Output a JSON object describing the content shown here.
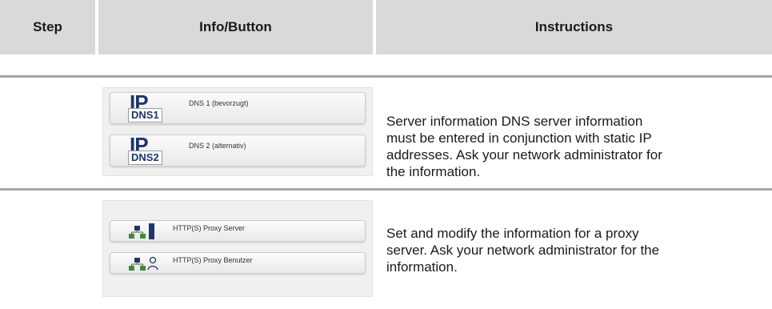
{
  "header": {
    "step": "Step",
    "info_button": "Info/Button",
    "instructions": "Instructions"
  },
  "rows": [
    {
      "buttons": [
        {
          "icon": "ip-dns1-icon",
          "icon_text": "DNS1",
          "label": "DNS 1 (bevorzugt)"
        },
        {
          "icon": "ip-dns2-icon",
          "icon_text": "DNS2",
          "label": "DNS 2 (alternativ)"
        }
      ],
      "ip_text": "IP",
      "lines": [
        "Server information DNS server information",
        "must be entered in conjunction with static IP",
        "addresses. Ask your network administrator for",
        "the information."
      ]
    },
    {
      "buttons": [
        {
          "icon": "proxy-server-icon",
          "label": "HTTP(S) Proxy Server"
        },
        {
          "icon": "proxy-user-icon",
          "label": "HTTP(S) Proxy Benutzer"
        }
      ],
      "lines": [
        "Set and modify the information for a proxy",
        "server. Ask your network administrator for the",
        "information."
      ]
    }
  ],
  "colors": {
    "header_bg": "#d9d9d9",
    "rule": "#a6a6a6",
    "icon_navy": "#1d3569",
    "network_green": "#3f8a3a"
  }
}
